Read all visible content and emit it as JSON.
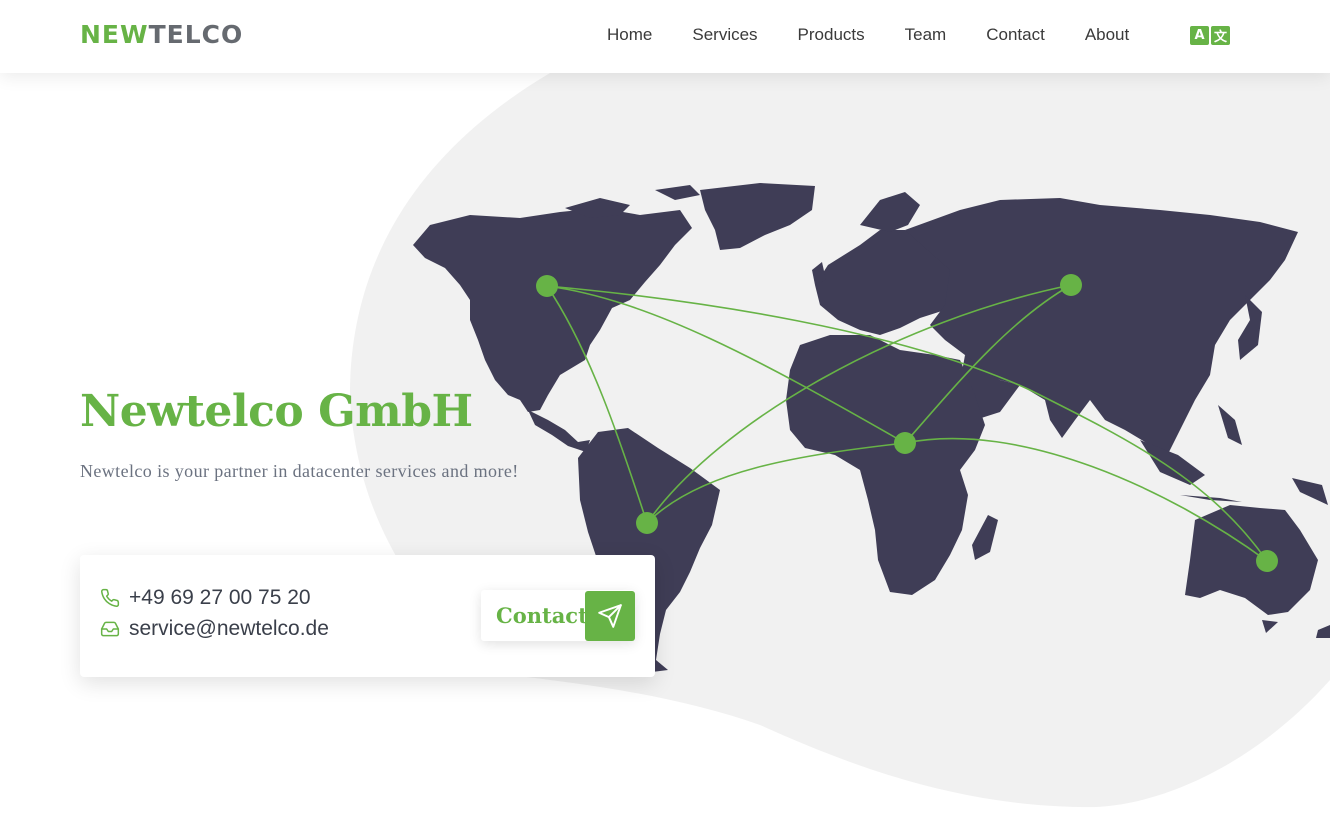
{
  "brand": {
    "logo_part1": "NEW",
    "logo_part2": "TELCO"
  },
  "nav": {
    "items": [
      {
        "label": "Home"
      },
      {
        "label": "Services"
      },
      {
        "label": "Products"
      },
      {
        "label": "Team"
      },
      {
        "label": "Contact"
      },
      {
        "label": "About"
      }
    ],
    "language_icon": "translate-icon",
    "language_glyphs": [
      "A",
      "文"
    ]
  },
  "hero": {
    "title": "Newtelco GmbH",
    "subtitle": "Newtelco is your partner in datacenter services and more!"
  },
  "contact_card": {
    "phone": "+49 69 27 00 75 20",
    "phone_icon": "phone-icon",
    "email": "service@newtelco.de",
    "email_icon": "inbox-icon",
    "button_label": "Contact",
    "button_icon": "send-icon"
  },
  "illustration": {
    "name": "world-network-map",
    "nodes": 5
  },
  "colors": {
    "accent": "#67b346",
    "map_land": "#3f3d56",
    "blob": "#f1f1f1",
    "logo_gray": "#666a70",
    "subtitle": "#6b7280"
  }
}
